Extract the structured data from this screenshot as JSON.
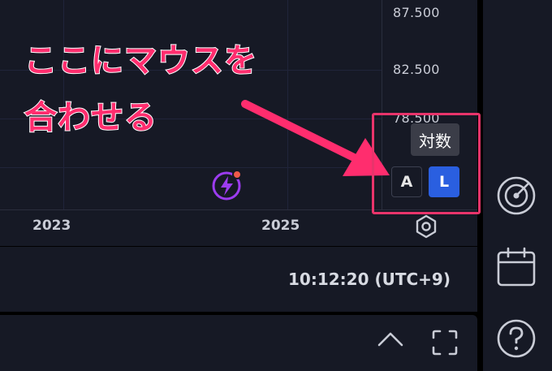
{
  "price_scale": {
    "labels": [
      "87.500",
      "82.500",
      "78.500"
    ]
  },
  "time_scale": {
    "labels": [
      "2023",
      "2025"
    ]
  },
  "annotation": {
    "line1": "ここにマウスを",
    "line2": "合わせる",
    "color": "#ff2d6e"
  },
  "scale_controls": {
    "tooltip": "対数",
    "auto_label": "A",
    "log_label": "L",
    "log_active_color": "#2a5fe0",
    "highlight_color": "#e8346b"
  },
  "status_bar": {
    "time": "10:12:20 (UTC+9)"
  },
  "icons": {
    "lightning": "lightning-icon",
    "settings": "hexagon-settings-icon",
    "collapse": "chevron-up-icon",
    "maximize": "maximize-icon",
    "radar": "radar-icon",
    "calendar": "calendar-icon",
    "help": "help-icon"
  }
}
